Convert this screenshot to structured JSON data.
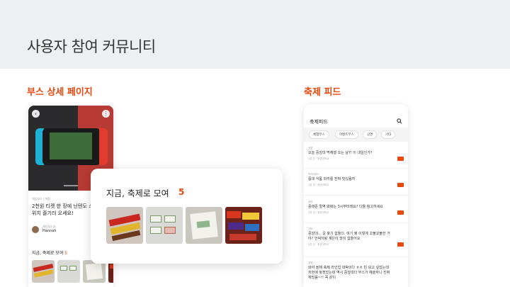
{
  "page": {
    "title": "사용자 참여 커뮤니티"
  },
  "sections": {
    "booth_detail": "부스 상세 페이지",
    "festival_feed": "축제 피드"
  },
  "booth": {
    "back_icon": "chevron-left-icon",
    "more_icon": "more-vertical-icon",
    "tag": "게임부스 | 체험",
    "headline": "2천원 티켓 한 장에 닌텐도 스위치 즐기러 오세요!",
    "author_role": "게임부스장",
    "author_name": "Hannah",
    "section_label": "지금, 축제로 모여",
    "section_count": "5"
  },
  "popup": {
    "title": "지금, 축제로 모여",
    "count": "5"
  },
  "feed": {
    "title": "축제피드",
    "search_icon": "search-icon",
    "chips": [
      "체험부스",
      "이벤트부스",
      "공연",
      "기타"
    ],
    "posts": [
      {
        "category": "공연",
        "text": "오늘 중앙대 먹채행 오는 날?! 이 내일인가?",
        "meta": "1분 전 · 중앙대학교"
      },
      {
        "category": "먹거리부스",
        "text": "중대 식품 마카롱 진짜 맛있음여",
        "meta": "1분 전 · 중앙대학교"
      },
      {
        "category": "공연",
        "text": "중대존 멀역 봐봐는 3시부터래요? 다들 참고하세요",
        "meta": "3분 전 · 중앙대학교"
      },
      {
        "category": "기타",
        "text": "중앙대... 길 찾기 힘들다. 여기 왜 이렇게 꼬불꼬불한 거야? 언덕이랑 계단이 많이 힘들어요",
        "meta": "5분 전 · 중앙대학교"
      },
      {
        "category": "공연",
        "text": "와야 올해 축제 라인업 대박이다 ㅎㅎ 빈 보고 싶었는데 저번에 놓쳤었는데 역시 중앙대다 부스가 예술하니 진짜 재밌음~!! 꼭 같이",
        "meta": ""
      }
    ]
  },
  "colors": {
    "accent": "#e8470e",
    "header_bg": "#eeeff1"
  }
}
